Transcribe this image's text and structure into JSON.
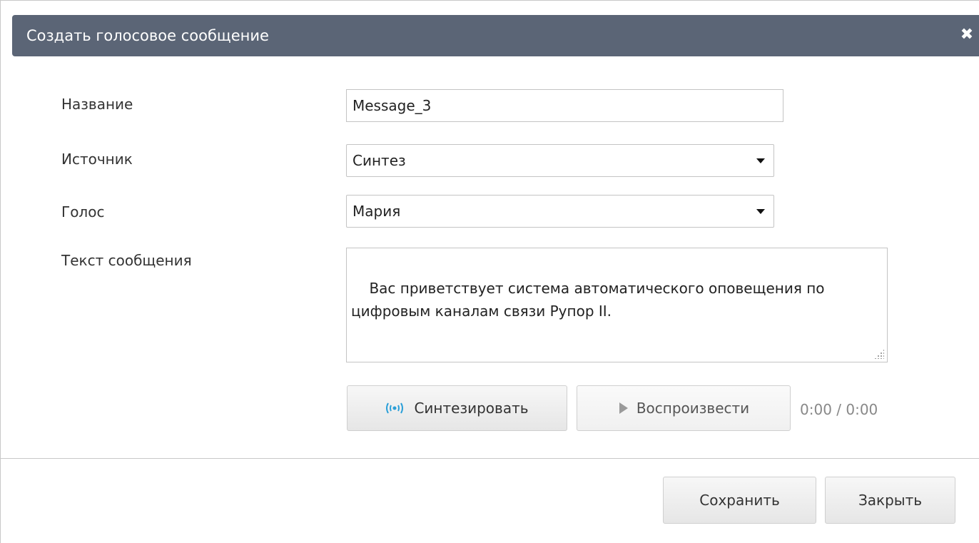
{
  "dialog": {
    "title": "Создать голосовое сообщение",
    "close_icon": "close-icon"
  },
  "form": {
    "name": {
      "label": "Название",
      "value": "Message_3"
    },
    "source": {
      "label": "Источник",
      "value": "Синтез"
    },
    "voice": {
      "label": "Голос",
      "value": "Мария"
    },
    "text": {
      "label": "Текст сообщения",
      "value": "Вас приветствует система автоматического оповещения по цифровым каналам связи Рупор II."
    }
  },
  "player": {
    "synthesize_label": "Синтезировать",
    "synthesize_icon": "sound-waves-icon",
    "play_label": "Воспроизвести",
    "play_icon": "play-icon",
    "time": "0:00 / 0:00"
  },
  "footer": {
    "save_label": "Сохранить",
    "close_label": "Закрыть"
  },
  "colors": {
    "titlebar": "#5b6576",
    "synth_icon": "#2a9fd8"
  }
}
